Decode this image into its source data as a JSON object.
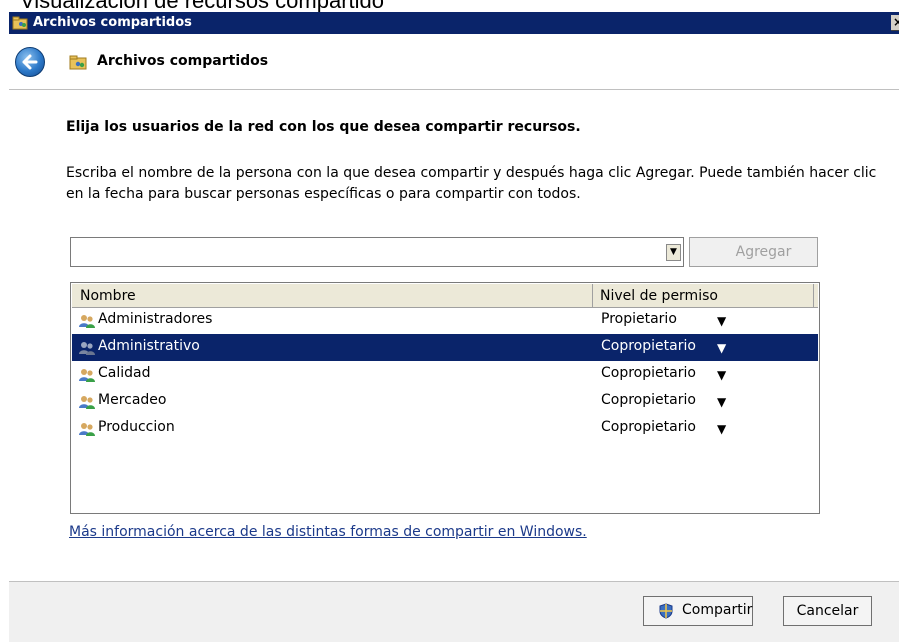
{
  "caption_above": "Visualización de recursos compartido",
  "window": {
    "title": "Archivos compartidos",
    "close_glyph": "×"
  },
  "nav": {
    "title": "Archivos compartidos"
  },
  "main": {
    "heading": "Elija los usuarios de la red con los que desea compartir recursos.",
    "description": "Escriba el nombre de la persona con la que desea compartir y después haga clic Agregar. Puede también hacer clic en la fecha para buscar personas específicas o para compartir con todos.",
    "combo_value": "",
    "add_label": "Agregar"
  },
  "list": {
    "columns": [
      "Nombre",
      "Nivel de permiso"
    ],
    "rows": [
      {
        "name": "Administradores",
        "permission": "Propietario",
        "icon": "group-users-icon",
        "selected": false
      },
      {
        "name": "Administrativo",
        "permission": "Copropietario",
        "icon": "group-users-icon",
        "selected": true
      },
      {
        "name": "Calidad",
        "permission": "Copropietario",
        "icon": "group-users-icon",
        "selected": false
      },
      {
        "name": "Mercadeo",
        "permission": "Copropietario",
        "icon": "group-users-icon",
        "selected": false
      },
      {
        "name": "Produccion",
        "permission": "Copropietario",
        "icon": "group-users-icon",
        "selected": false
      }
    ]
  },
  "link": {
    "text": "Más información acerca de las distintas formas de compartir en Windows."
  },
  "footer": {
    "share_label": "Compartir",
    "cancel_label": "Cancelar"
  },
  "colors": {
    "titlebar": "#0a246a",
    "selection": "#0a246a",
    "link": "#1c3a8a"
  }
}
